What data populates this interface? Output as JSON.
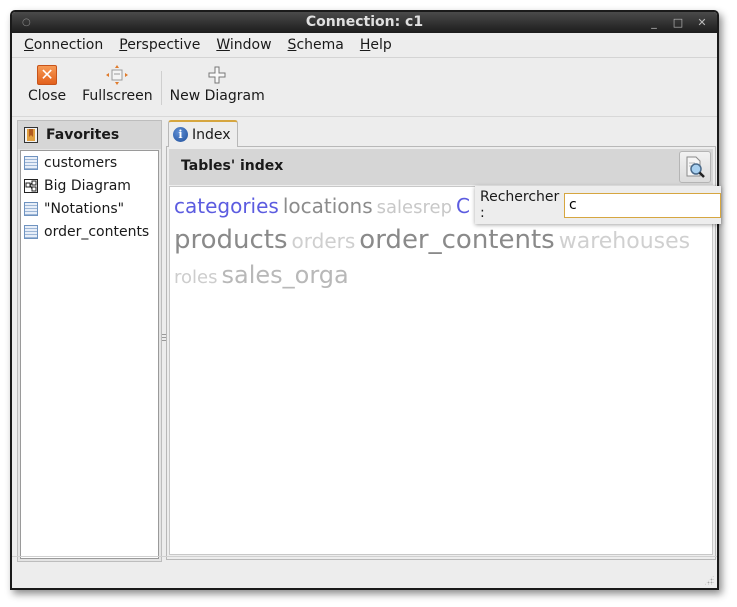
{
  "window": {
    "title": "Connection: c1",
    "controls": [
      "minimize",
      "maximize",
      "close"
    ]
  },
  "menubar": [
    {
      "mnemonic": "C",
      "rest": "onnection"
    },
    {
      "mnemonic": "P",
      "rest": "erspective"
    },
    {
      "mnemonic": "W",
      "rest": "indow"
    },
    {
      "mnemonic": "S",
      "rest": "chema"
    },
    {
      "mnemonic": "H",
      "rest": "elp"
    }
  ],
  "toolbar": {
    "close_label": "Close",
    "fullscreen_label": "Fullscreen",
    "new_diagram_label": "New Diagram"
  },
  "favorites": {
    "title": "Favorites",
    "items": [
      {
        "label": "customers",
        "icon": "table-icon"
      },
      {
        "label": "Big Diagram",
        "icon": "diagram-icon"
      },
      {
        "label": "\"Notations\"",
        "icon": "table-icon"
      },
      {
        "label": "order_contents",
        "icon": "table-icon"
      }
    ]
  },
  "tabs": [
    {
      "label": "Index",
      "icon": "info-icon",
      "active": true
    }
  ],
  "index": {
    "title": "Tables' index",
    "search_label": "Rechercher :",
    "search_value": "c",
    "tags": [
      {
        "text": "categories",
        "color": "#5c5ce0",
        "size": 20
      },
      {
        "text": "locations",
        "color": "#8c8c8c",
        "size": 20
      },
      {
        "text": "salesrep",
        "color": "#c8c8c8",
        "size": 18
      },
      {
        "text": "C",
        "color": "#5c5ce0",
        "size": 20
      },
      {
        "text": "products",
        "color": "#8a8a8a",
        "size": 26
      },
      {
        "text": "orders",
        "color": "#cfcfcf",
        "size": 20
      },
      {
        "text": "order_contents",
        "color": "#8a8a8a",
        "size": 26
      },
      {
        "text": "warehouses",
        "color": "#d0d0d0",
        "size": 22
      },
      {
        "text": "roles",
        "color": "#cdcdcd",
        "size": 18
      },
      {
        "text": "sales_orga",
        "color": "#b8b8b8",
        "size": 24
      }
    ]
  }
}
